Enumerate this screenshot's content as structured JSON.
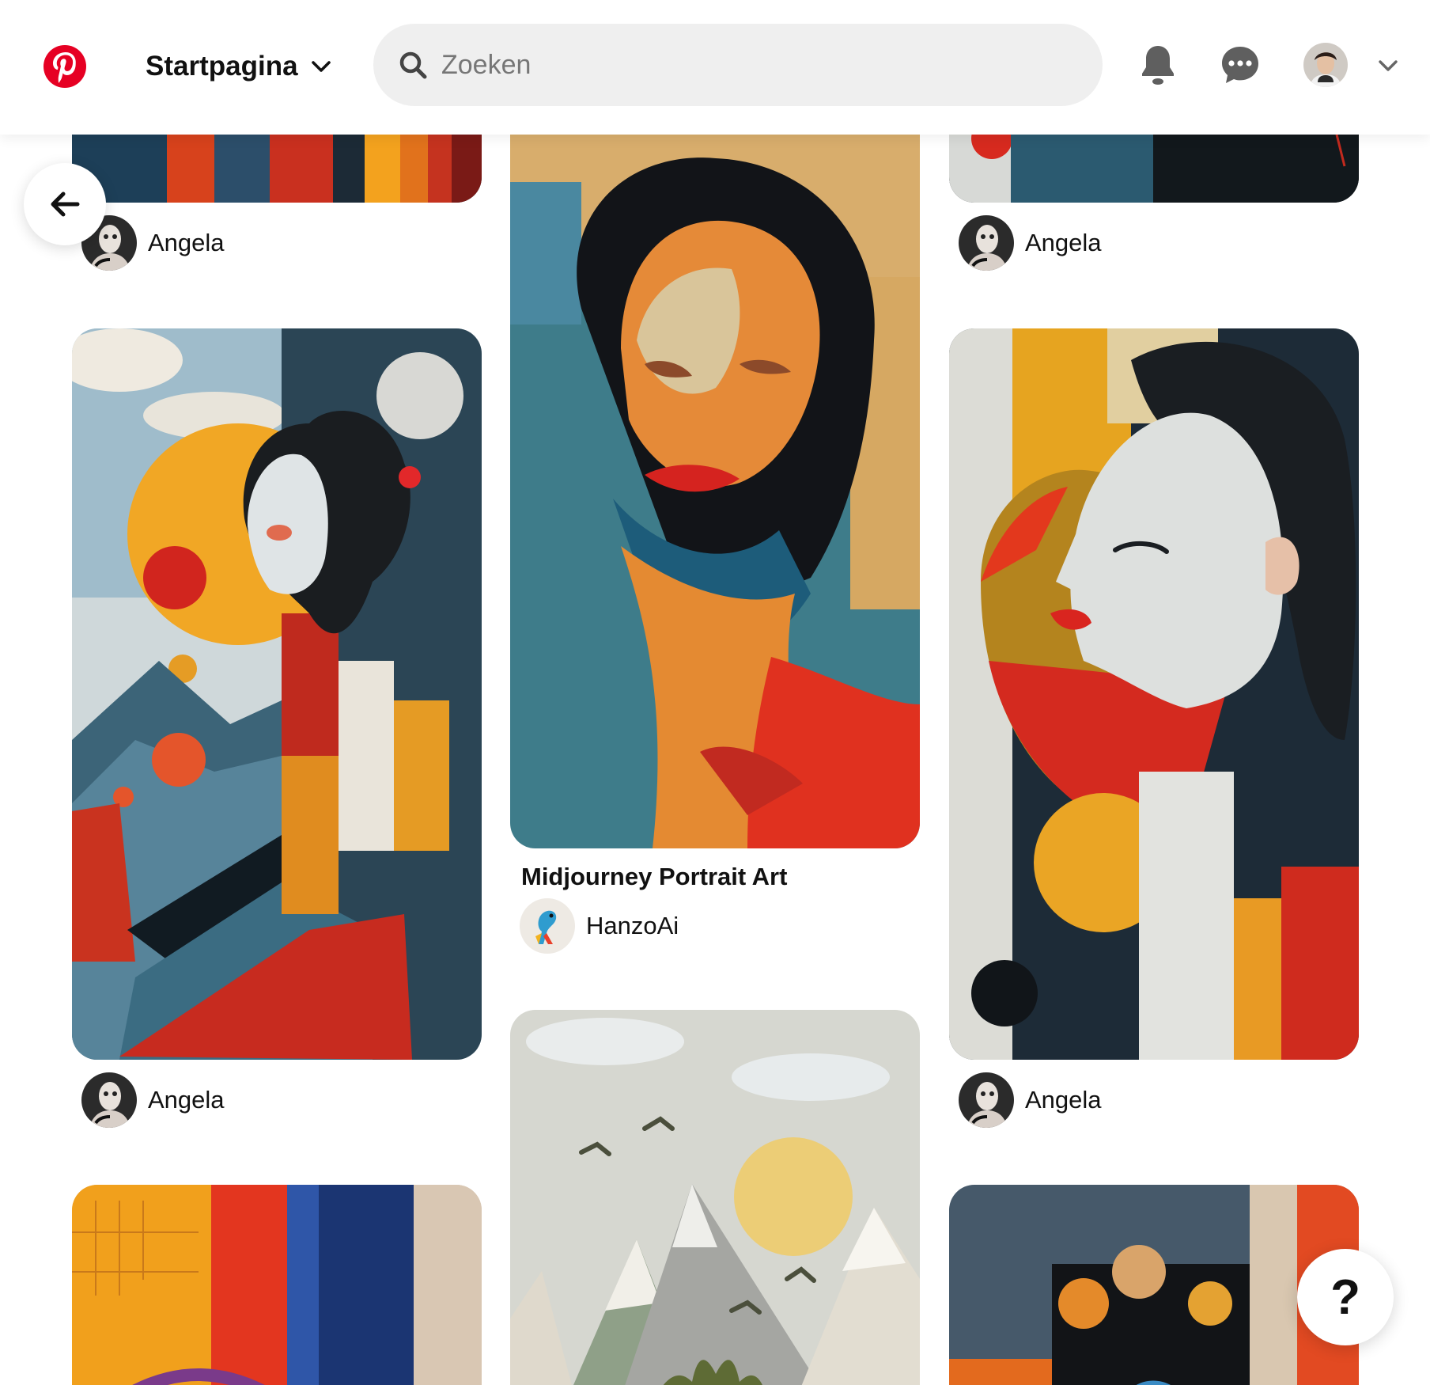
{
  "header": {
    "home_label": "Startpagina",
    "search_placeholder": "Zoeken",
    "brand_color": "#E60023"
  },
  "floating": {
    "help_label": "?"
  },
  "icons": [
    "pinterest-logo",
    "chevron-down-icon",
    "search-icon",
    "bell-icon",
    "chat-icon",
    "avatar",
    "arrow-left-icon",
    "question-icon"
  ],
  "pins": [
    {
      "author": "Angela"
    },
    {
      "author": "Angela"
    },
    {
      "title": "Midjourney Portrait Art",
      "author": "HanzoAi"
    },
    {
      "author": "Angela"
    },
    {
      "author": "Angela"
    }
  ]
}
